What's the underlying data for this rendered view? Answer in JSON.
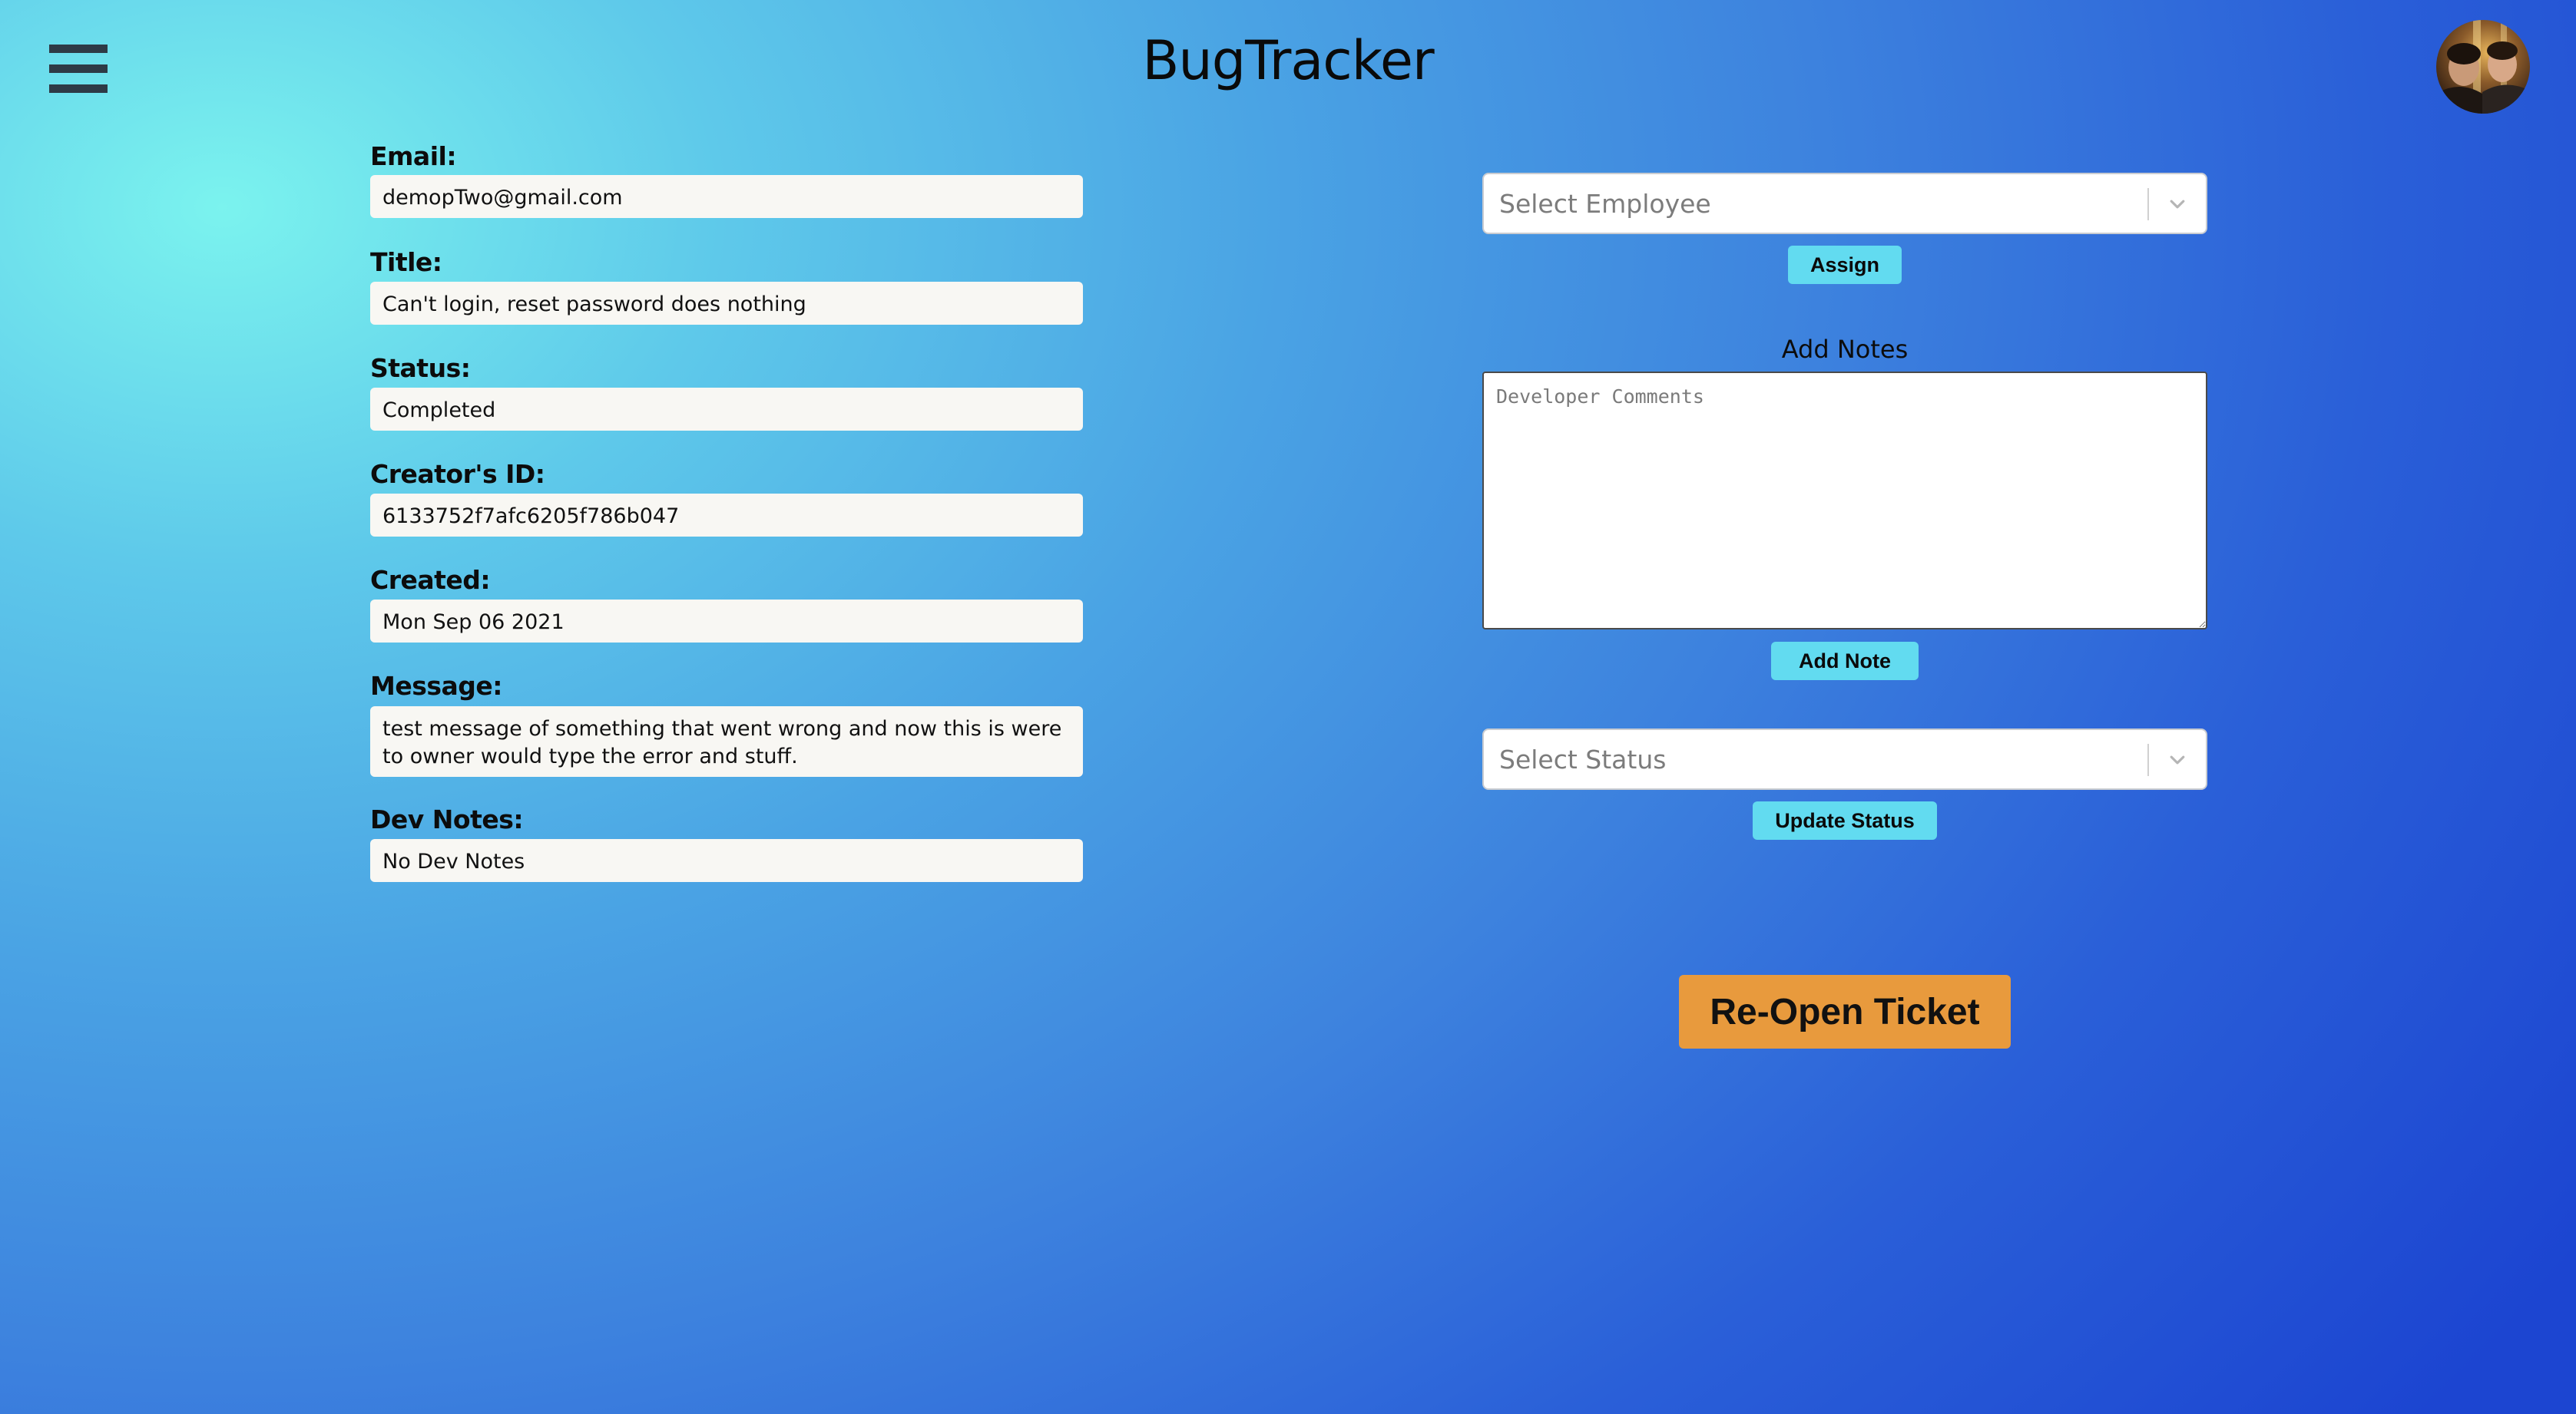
{
  "header": {
    "title": "BugTracker",
    "menu_icon": "hamburger-menu-icon",
    "avatar_icon": "user-avatar"
  },
  "ticket": {
    "email_label": "Email:",
    "email_value": "demopTwo@gmail.com",
    "title_label": "Title:",
    "title_value": "Can't login, reset password does nothing",
    "status_label": "Status:",
    "status_value": "Completed",
    "creator_label": "Creator's ID:",
    "creator_value": "6133752f7afc6205f786b047",
    "created_label": "Created:",
    "created_value": "Mon Sep 06 2021",
    "message_label": "Message:",
    "message_value": "test message of something that went wrong and now this is were to owner would type the error and stuff.",
    "devnotes_label": "Dev Notes:",
    "devnotes_value": "No Dev Notes"
  },
  "actions": {
    "employee_placeholder": "Select Employee",
    "assign_label": "Assign",
    "notes_heading": "Add Notes",
    "notes_placeholder": "Developer Comments",
    "add_note_label": "Add Note",
    "status_placeholder": "Select Status",
    "update_status_label": "Update Status",
    "reopen_label": "Re-Open Ticket"
  },
  "colors": {
    "gradient_light": "#7bf3ee",
    "gradient_dark": "#1c45d1",
    "small_button": "#62dbf0",
    "reopen_button": "#e89a3d",
    "field_background": "#f8f7f3"
  }
}
